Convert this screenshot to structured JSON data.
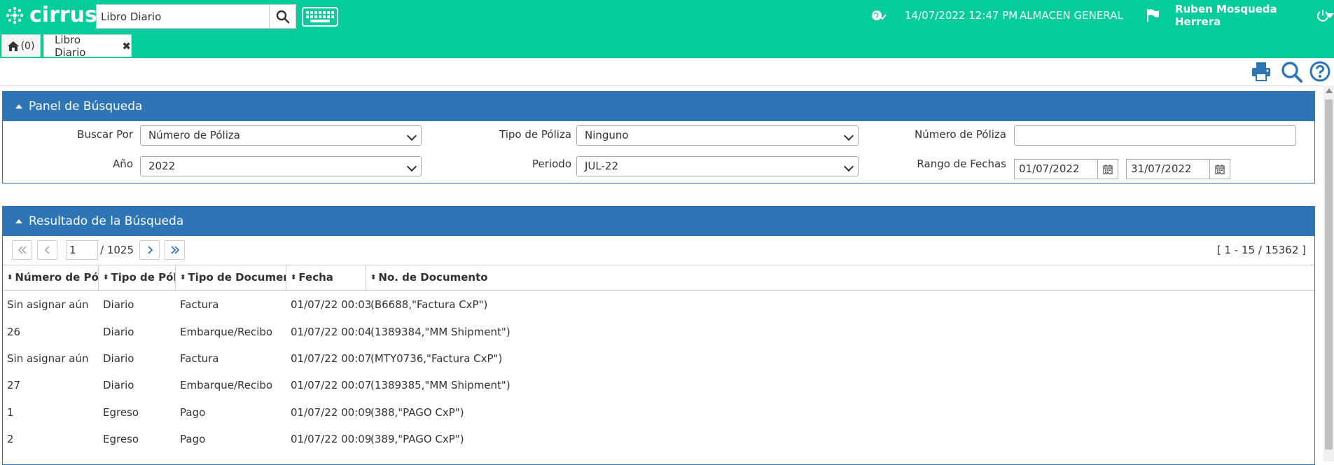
{
  "header": {
    "logo_text": "cirrus",
    "search_value": "Libro Diario",
    "datetime": "14/07/2022 12:47 PM",
    "warehouse": "ALMACEN GENERAL",
    "user_name": "Ruben Mosqueda Herrera",
    "accent_color": "#04cc9a"
  },
  "tabs": {
    "home_count": "(0)",
    "active_tab": "Libro Diario",
    "close_glyph": "✖"
  },
  "search_panel": {
    "title": "Panel de Búsqueda",
    "buscar_por_label": "Buscar Por",
    "buscar_por_value": "Número de Póliza",
    "tipo_poliza_label": "Tipo de Póliza",
    "tipo_poliza_value": "Ninguno",
    "numero_poliza_label": "Número de Póliza",
    "numero_poliza_value": "",
    "anio_label": "Año",
    "anio_value": "2022",
    "periodo_label": "Periodo",
    "periodo_value": "JUL-22",
    "rango_label": "Rango de Fechas",
    "fecha_inicio": "01/07/2022",
    "fecha_fin": "31/07/2022"
  },
  "results_panel": {
    "title": "Resultado de la Búsqueda",
    "page_current": "1",
    "page_total": "/ 1025",
    "range_text": "[ 1 - 15 / 15362 ]",
    "columns": [
      "Número de Póliza",
      "Tipo de Póliza",
      "Tipo de Documento",
      "Fecha",
      "No. de Documento"
    ],
    "rows": [
      [
        "Sin asignar aún",
        "Diario",
        "Factura",
        "01/07/22 00:03",
        "(B6688,\"Factura CxP\")"
      ],
      [
        "26",
        "Diario",
        "Embarque/Recibo",
        "01/07/22 00:04",
        "(1389384,\"MM Shipment\")"
      ],
      [
        "Sin asignar aún",
        "Diario",
        "Factura",
        "01/07/22 00:07",
        "(MTY0736,\"Factura CxP\")"
      ],
      [
        "27",
        "Diario",
        "Embarque/Recibo",
        "01/07/22 00:07",
        "(1389385,\"MM Shipment\")"
      ],
      [
        "1",
        "Egreso",
        "Pago",
        "01/07/22 00:09",
        "(388,\"PAGO CxP\")"
      ],
      [
        "2",
        "Egreso",
        "Pago",
        "01/07/22 00:09",
        "(389,\"PAGO CxP\")"
      ]
    ]
  },
  "header_color": "#2e75b6"
}
